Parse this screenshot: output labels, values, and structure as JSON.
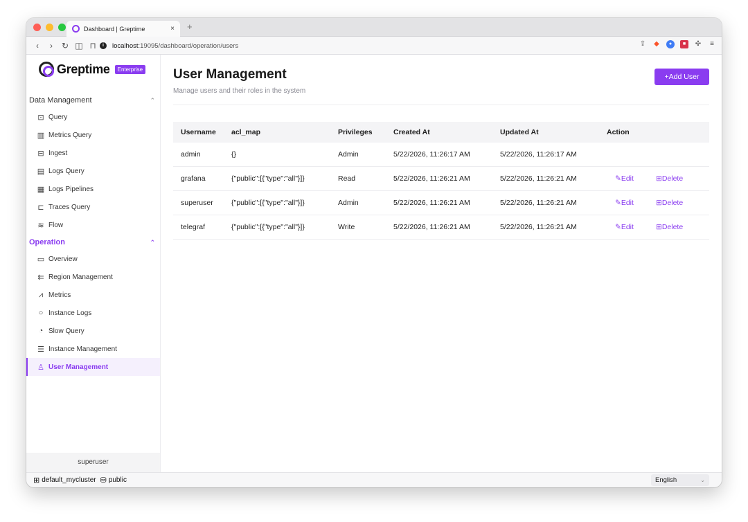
{
  "browser": {
    "tab_title": "Dashboard | Greptime",
    "tab_close": "×",
    "new_tab": "+",
    "url_host": "localhost",
    "url_path": ":19095/dashboard/operation/users"
  },
  "brand": {
    "name": "Greptime",
    "badge": "Enterprise",
    "accent_color": "#8a3cf0"
  },
  "sidebar": {
    "sections": [
      {
        "label": "Data Management",
        "items": [
          {
            "label": "Query",
            "icon": "query-icon"
          },
          {
            "label": "Metrics Query",
            "icon": "metrics-query-icon"
          },
          {
            "label": "Ingest",
            "icon": "ingest-icon"
          },
          {
            "label": "Logs Query",
            "icon": "logs-query-icon"
          },
          {
            "label": "Logs Pipelines",
            "icon": "pipelines-icon"
          },
          {
            "label": "Traces Query",
            "icon": "traces-icon"
          },
          {
            "label": "Flow",
            "icon": "flow-icon"
          }
        ]
      },
      {
        "label": "Operation",
        "items": [
          {
            "label": "Overview",
            "icon": "monitor-icon"
          },
          {
            "label": "Region Management",
            "icon": "region-icon"
          },
          {
            "label": "Metrics",
            "icon": "line-chart-icon"
          },
          {
            "label": "Instance Logs",
            "icon": "search-icon"
          },
          {
            "label": "Slow Query",
            "icon": "gauge-icon"
          },
          {
            "label": "Instance Management",
            "icon": "server-icon"
          },
          {
            "label": "User Management",
            "icon": "user-icon",
            "active": true
          }
        ]
      }
    ],
    "current_user": "superuser"
  },
  "page": {
    "title": "User Management",
    "subtitle": "Manage users and their roles in the system",
    "add_button": "+Add User"
  },
  "table": {
    "columns": [
      "Username",
      "acl_map",
      "Privileges",
      "Created At",
      "Updated At",
      "Action"
    ],
    "rows": [
      {
        "username": "admin",
        "acl_map": "{}",
        "privileges": "Admin",
        "created": "5/22/2026, 11:26:17 AM",
        "updated": "5/22/2026, 11:26:17 AM",
        "actions": false
      },
      {
        "username": "grafana",
        "acl_map": "{\"public\":[{\"type\":\"all\"}]}",
        "privileges": "Read",
        "created": "5/22/2026, 11:26:21 AM",
        "updated": "5/22/2026, 11:26:21 AM",
        "actions": true
      },
      {
        "username": "superuser",
        "acl_map": "{\"public\":[{\"type\":\"all\"}]}",
        "privileges": "Admin",
        "created": "5/22/2026, 11:26:21 AM",
        "updated": "5/22/2026, 11:26:21 AM",
        "actions": true
      },
      {
        "username": "telegraf",
        "acl_map": "{\"public\":[{\"type\":\"all\"}]}",
        "privileges": "Write",
        "created": "5/22/2026, 11:26:21 AM",
        "updated": "5/22/2026, 11:26:21 AM",
        "actions": true
      }
    ],
    "edit_label": "Edit",
    "delete_label": "Delete"
  },
  "statusbar": {
    "cluster": "default_mycluster",
    "database": "public",
    "language": "English"
  }
}
